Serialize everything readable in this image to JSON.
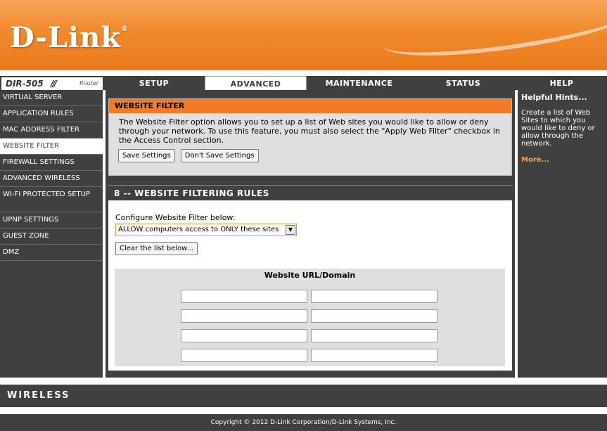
{
  "brand": {
    "logo_text": "D-Link",
    "logo_mark": "®",
    "accent": "#f27b23",
    "dark": "#404040"
  },
  "model": {
    "name": "DIR-505",
    "slashes": "///",
    "type": "Router"
  },
  "tabs": [
    {
      "label": "SETUP"
    },
    {
      "label": "ADVANCED"
    },
    {
      "label": "MAINTENANCE"
    },
    {
      "label": "STATUS"
    },
    {
      "label": "HELP"
    }
  ],
  "sidebar": {
    "items": [
      {
        "label": "VIRTUAL SERVER"
      },
      {
        "label": "APPLICATION RULES"
      },
      {
        "label": "MAC ADDRESS FILTER"
      },
      {
        "label": "WEBSITE FILTER"
      },
      {
        "label": "FIREWALL SETTINGS"
      },
      {
        "label": "ADVANCED WIRELESS"
      },
      {
        "label": "WI-FI PROTECTED SETUP"
      },
      {
        "label": "UPNP SETTINGS"
      },
      {
        "label": "GUEST ZONE"
      },
      {
        "label": "DMZ"
      }
    ]
  },
  "filter": {
    "title": "WEBSITE FILTER",
    "description": "The Website Filter option allows you to set up a list of Web sites you would like to allow or deny through your network. To use this feature, you must also select the \"Apply Web Filter\" checkbox in the Access Control section.",
    "save_label": "Save Settings",
    "dont_save_label": "Don't Save Settings"
  },
  "rules": {
    "title": "8 -- WEBSITE FILTERING RULES",
    "configure_label": "Configure Website Filter below:",
    "selected_option": "ALLOW computers access to ONLY these sites",
    "clear_label": "Clear the list below...",
    "column_header": "Website URL/Domain",
    "urls": [
      "",
      "",
      "",
      "",
      "",
      "",
      "",
      ""
    ]
  },
  "help": {
    "title": "Helpful Hints...",
    "text": "Create a list of Web Sites to which you would like to deny or allow through the network.",
    "more": "More..."
  },
  "footer": {
    "wireless": "WIRELESS",
    "copyright": "Copyright © 2012 D-Link Corporation/D-Link Systems, Inc."
  }
}
